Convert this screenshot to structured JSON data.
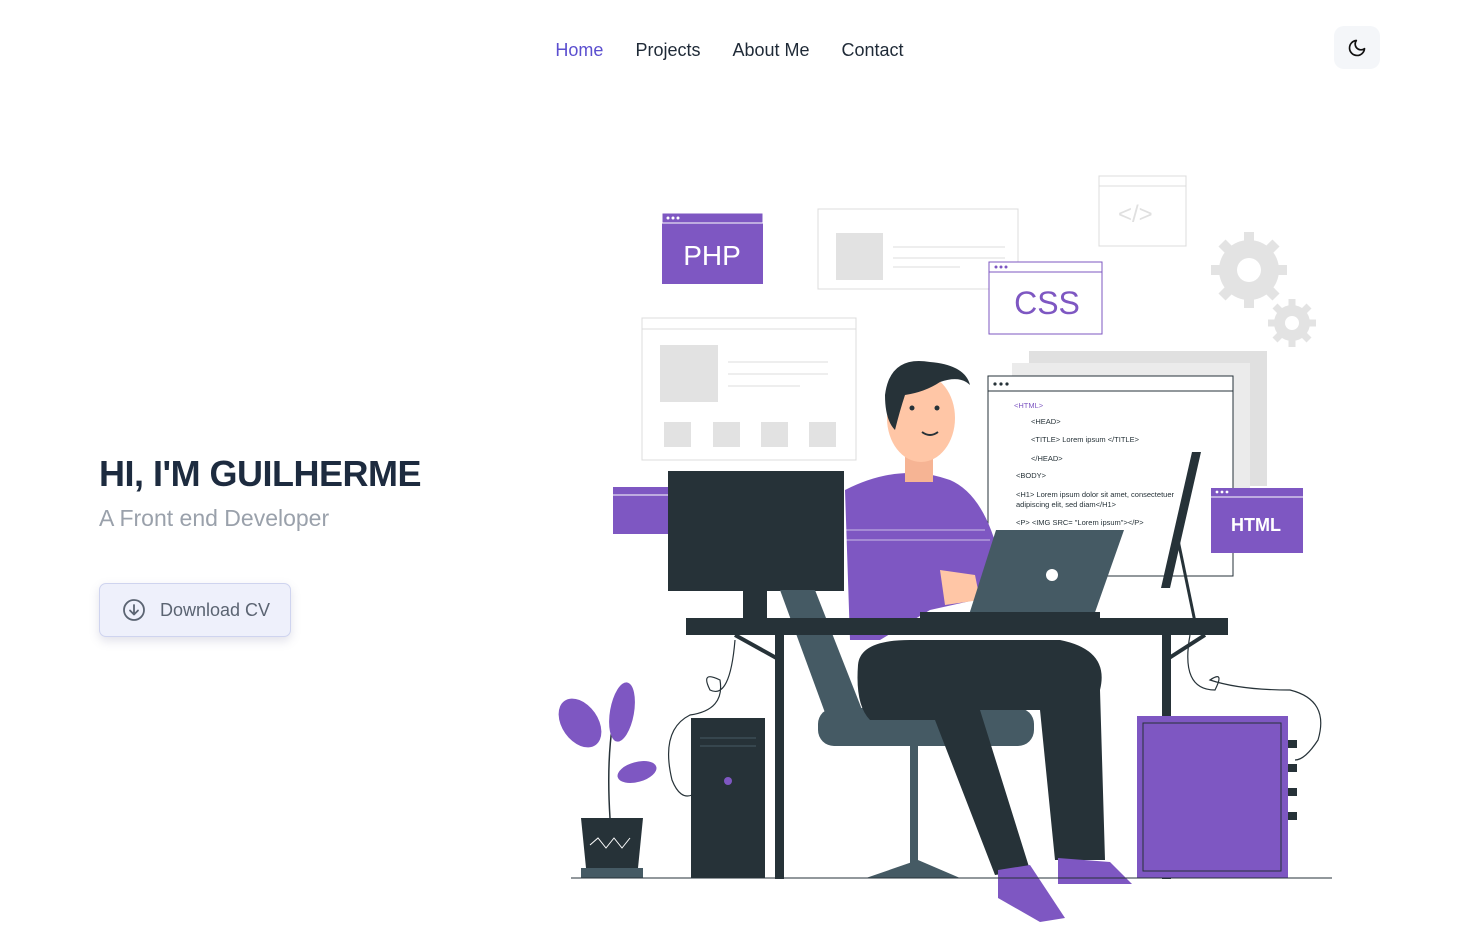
{
  "nav": {
    "items": [
      {
        "label": "Home",
        "active": true
      },
      {
        "label": "Projects",
        "active": false
      },
      {
        "label": "About Me",
        "active": false
      },
      {
        "label": "Contact",
        "active": false
      }
    ],
    "theme_toggle_icon": "moon-icon"
  },
  "hero": {
    "title": "HI, I'M GUILHERME",
    "subtitle": "A Front end Developer",
    "cv_button": {
      "label": "Download CV",
      "icon": "download-circle-icon"
    }
  },
  "illustration": {
    "php_label": "PHP",
    "css_label": "CSS",
    "html_label": "HTML",
    "code_lines": [
      "<HTML>",
      "<HEAD>",
      "<TITLE> Lorem ipsum </TITLE>",
      "</HEAD>",
      "<BODY>",
      "<H1> Lorem ipsum dolor sit amet, consectetuer",
      "adipiscing elit, sed diam</H1>",
      "<P> <IMG SRC= \"Lorem ipsum\"></P>"
    ]
  },
  "colors": {
    "accent": "#7e57c2",
    "dark": "#263238",
    "nav_active": "#5b4fcf",
    "title": "#1d2b3f"
  }
}
